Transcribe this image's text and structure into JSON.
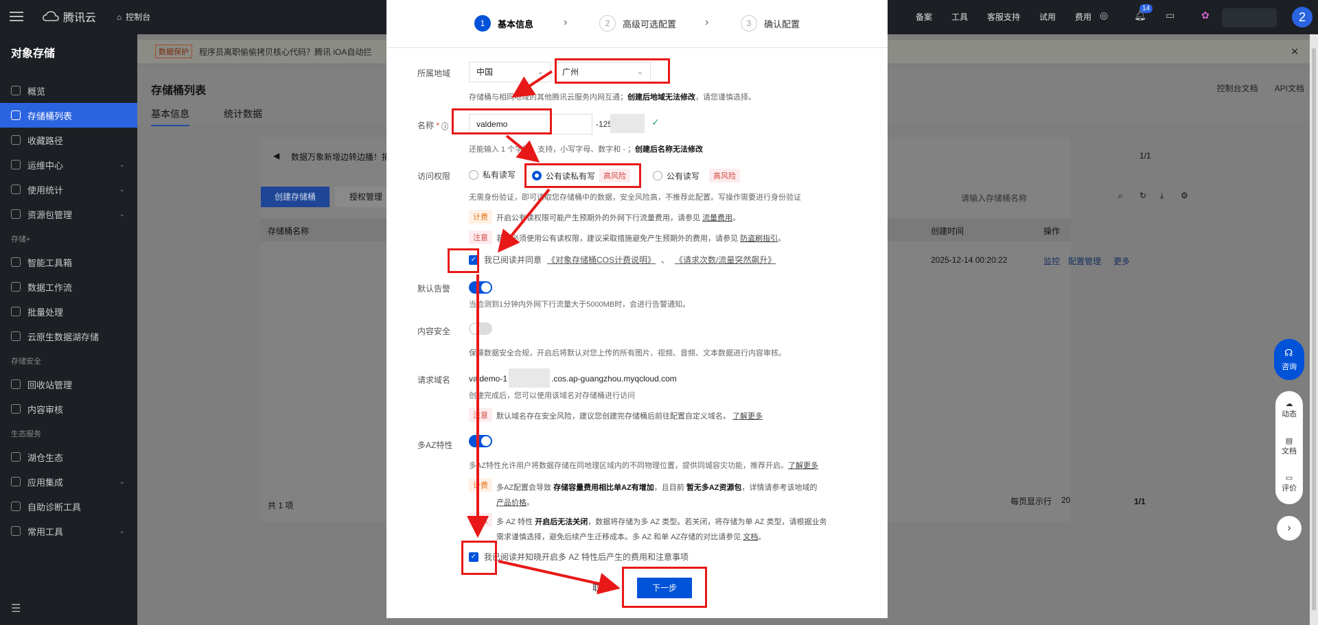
{
  "topbar": {
    "brand": "腾讯云",
    "console": "控制台",
    "right_items": [
      "备案",
      "工具",
      "客服支持",
      "试用",
      "费用"
    ],
    "notification_count": "14",
    "avatar_letter": "2"
  },
  "sidebar": {
    "title": "对象存储",
    "items": [
      {
        "label": "概览",
        "icon": "overview-icon"
      },
      {
        "label": "存储桶列表",
        "icon": "bucket-icon",
        "active": true
      },
      {
        "label": "收藏路径",
        "icon": "link-icon"
      },
      {
        "label": "运维中心",
        "icon": "ops-icon",
        "chevron": true
      },
      {
        "label": "使用统计",
        "icon": "stats-icon",
        "chevron": true
      },
      {
        "label": "资源包管理",
        "icon": "package-icon",
        "chevron": true
      }
    ],
    "group_plus": "存储+",
    "items_plus": [
      {
        "label": "智能工具箱"
      },
      {
        "label": "数据工作流"
      },
      {
        "label": "批量处理"
      },
      {
        "label": "云原生数据湖存储"
      }
    ],
    "group_security": "存储安全",
    "items_security": [
      {
        "label": "回收站管理"
      },
      {
        "label": "内容审核"
      }
    ],
    "group_eco": "生态服务",
    "items_eco": [
      {
        "label": "湖仓生态"
      },
      {
        "label": "应用集成",
        "chevron": true
      },
      {
        "label": "自助诊断工具"
      },
      {
        "label": "常用工具",
        "chevron": true
      }
    ]
  },
  "background": {
    "notice_tag": "数据保护",
    "notice_text": "程序员离职偷偷拷贝核心代码？腾讯 iOA自动拦",
    "page_title": "存储桶列表",
    "tabs": [
      "基本信息",
      "统计数据"
    ],
    "links": [
      "控制台文档",
      "API文档"
    ],
    "announce": "数据万象新增边转边播！捐",
    "create_btn": "创建存储桶",
    "auth_btn": "授权管理",
    "search_placeholder": "请输入存储桶名称",
    "col_name": "存储桶名称",
    "col_time": "创建时间",
    "col_ops": "操作",
    "row_time": "2025-12-14 00:20:22",
    "row_ops": [
      "监控",
      "配置管理",
      "更多"
    ],
    "total": "共 1 项",
    "per_page_label": "每页显示行",
    "per_page": "20",
    "page": "1/1",
    "page_top": "1/1"
  },
  "modal": {
    "steps": [
      {
        "num": "1",
        "label": "基本信息"
      },
      {
        "num": "2",
        "label": "高级可选配置"
      },
      {
        "num": "3",
        "label": "确认配置"
      }
    ],
    "region_label": "所属地域",
    "region_country": "中国",
    "region_city": "广州",
    "region_help_prefix": "存储桶与相同地域的其他腾讯云服务内网互通；",
    "region_help_bold": "创建后地域无法修改",
    "region_help_suffix": "，请您谨慎选择。",
    "name_label": "名称",
    "name_value": "valdemo",
    "name_suffix": "-125",
    "name_help_prefix": "还能输入 1 个字符，支持，小写字母、数字和 - ；",
    "name_help_bold": "创建后名称无法修改",
    "access_label": "访问权限",
    "access_options": [
      "私有读写",
      "公有读私有写",
      "公有读写"
    ],
    "risk": "高风险",
    "access_help": "无需身份验证，即可读取您存储桶中的数据，安全风险高，不推荐此配置。写操作需要进行身份验证",
    "fee_tag": "计费",
    "fee_text": "开启公有读权限可能产生预期外的外网下行流量费用，请参见",
    "fee_link": "流量费用",
    "note_tag": "注意",
    "note_text": "若您必须使用公有读权限，建议采取措施避免产生预期外的费用，请参见",
    "note_link": "防盗刷指引",
    "agree1_text": "我已阅读并同意",
    "agree1_link1": "《对象存储桶COS计费说明》",
    "agree1_link2": "《请求次数/流量突然飙升》",
    "alarm_label": "默认告警",
    "alarm_help": "当检测到1分钟内外网下行流量大于5000MB时，会进行告警通知。",
    "content_label": "内容安全",
    "content_help": "保障数据安全合规，开启后将默认对您上传的所有图片、视频、音频、文本数据进行内容审核。",
    "domain_label": "请求域名",
    "domain_prefix": "valdemo-1",
    "domain_suffix": ".cos.ap-guangzhou.myqcloud.com",
    "domain_help": "创建完成后，您可以使用该域名对存储桶进行访问",
    "domain_note": "默认域名存在安全风险，建议您创建完存储桶后前往配置自定义域名。",
    "learn_more": "了解更多",
    "az_label": "多AZ特性",
    "az_help": "多AZ特性允许用户将数据存储在同地理区域内的不同物理位置，提供同城容灾功能，推荐开启。",
    "az_fee_prefix": "多AZ配置会导致",
    "az_fee_bold1": "存储容量费用相比单AZ有增加",
    "az_fee_mid": "，且目前",
    "az_fee_bold2": "暂无多AZ资源包",
    "az_fee_suffix": "，详情请参考该地域的",
    "az_fee_link": "产品价格",
    "az_note_prefix": "多 AZ 特性",
    "az_note_bold": "开启后无法关闭",
    "az_note_suffix": "，数据将存储为多 AZ 类型。若关闭，将存储为单 AZ 类型，请根据业务",
    "az_note_line2": "需求谨慎选择，避免后续产生迁移成本。多 AZ 和单 AZ存储的对比请参见",
    "az_note_link": "文档",
    "agree2_text": "我已阅读并知晓开启多 AZ 特性后产生的费用和注意事项",
    "cancel": "取消",
    "next": "下一步"
  },
  "float": {
    "consult": "咨询",
    "items": [
      "动态",
      "文档",
      "评价"
    ]
  },
  "colors": {
    "primary": "#0052d9",
    "annotation": "#e81818",
    "risk": "#d54941",
    "fee": "#e37318"
  }
}
